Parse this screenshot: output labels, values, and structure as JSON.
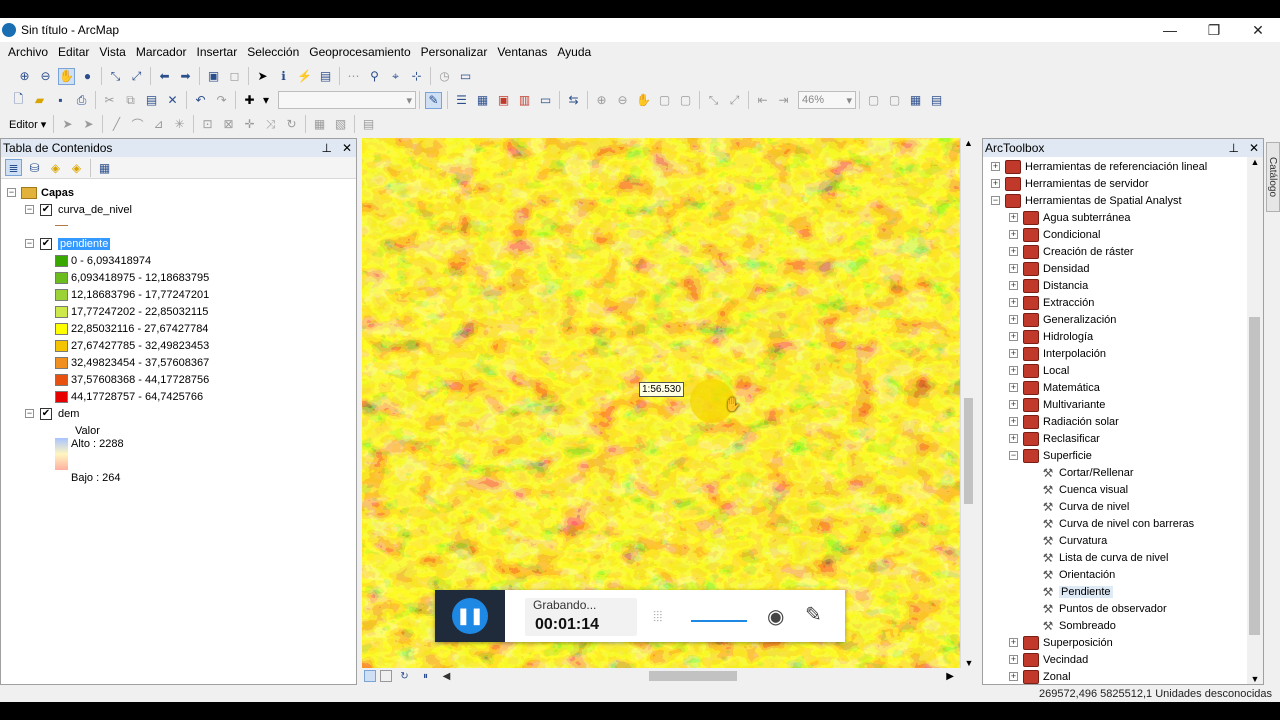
{
  "window": {
    "title": "Sin título - ArcMap",
    "minimize": "—",
    "restore": "❐",
    "close": "✕"
  },
  "menu": [
    "Archivo",
    "Editar",
    "Vista",
    "Marcador",
    "Insertar",
    "Selección",
    "Geoprocesamiento",
    "Personalizar",
    "Ventanas",
    "Ayuda"
  ],
  "toolbar": {
    "zoom_value": "46%",
    "editor_label": "Editor ▾"
  },
  "toc": {
    "title": "Tabla de Contenidos",
    "root": "Capas",
    "layers": {
      "curva": "curva_de_nivel",
      "pendiente": "pendiente",
      "dem": "dem"
    },
    "pendiente_classes": [
      {
        "label": "0 - 6,093418974",
        "color": "#38a800"
      },
      {
        "label": "6,093418975 - 12,18683795",
        "color": "#6bbd1e"
      },
      {
        "label": "12,18683796 - 17,77247201",
        "color": "#9bd235"
      },
      {
        "label": "17,77247202 - 22,85032115",
        "color": "#cde84a"
      },
      {
        "label": "22,85032116 - 27,67427784",
        "color": "#ffff00"
      },
      {
        "label": "27,67427785 - 32,49823453",
        "color": "#f5c400"
      },
      {
        "label": "32,49823454 - 37,57608367",
        "color": "#f09020"
      },
      {
        "label": "37,57608368 - 44,17728756",
        "color": "#e85010"
      },
      {
        "label": "44,17728757 - 64,7425766",
        "color": "#e60000"
      }
    ],
    "dem_value_label": "Valor",
    "dem_high": "Alto : 2288",
    "dem_low": "Bajo : 264"
  },
  "map": {
    "scale_tooltip": "1:56.530"
  },
  "arctoolbox": {
    "title": "ArcToolbox",
    "items_top": [
      "Herramientas de referenciación lineal",
      "Herramientas de servidor",
      "Herramientas de Spatial Analyst"
    ],
    "sa_items": [
      "Agua subterránea",
      "Condicional",
      "Creación de ráster",
      "Densidad",
      "Distancia",
      "Extracción",
      "Generalización",
      "Hidrología",
      "Interpolación",
      "Local",
      "Matemática",
      "Multivariante",
      "Radiación solar",
      "Reclasificar",
      "Superficie"
    ],
    "superficie_tools": [
      "Cortar/Rellenar",
      "Cuenca visual",
      "Curva de nivel",
      "Curva de nivel con barreras",
      "Curvatura",
      "Lista de curva de nivel",
      "Orientación",
      "Pendiente",
      "Puntos de observador",
      "Sombreado"
    ],
    "sa_items_bottom": [
      "Superposición",
      "Vecindad",
      "Zonal"
    ],
    "catalog_tab": "Catálogo"
  },
  "recorder": {
    "status": "Grabando...",
    "time": "00:01:14"
  },
  "status": {
    "coords": "269572,496  5825512,1 Unidades desconocidas"
  }
}
